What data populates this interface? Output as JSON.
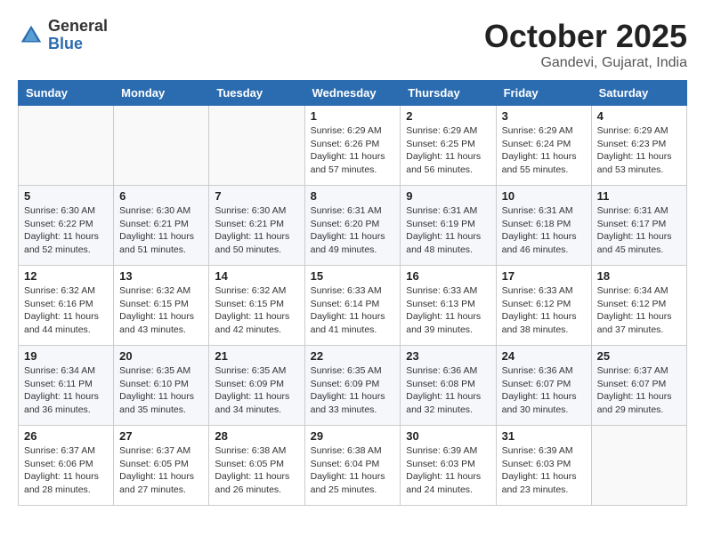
{
  "header": {
    "logo_general": "General",
    "logo_blue": "Blue",
    "month_title": "October 2025",
    "location": "Gandevi, Gujarat, India"
  },
  "weekdays": [
    "Sunday",
    "Monday",
    "Tuesday",
    "Wednesday",
    "Thursday",
    "Friday",
    "Saturday"
  ],
  "weeks": [
    [
      null,
      null,
      null,
      {
        "day": 1,
        "sunrise": "6:29 AM",
        "sunset": "6:26 PM",
        "daylight": "11 hours and 57 minutes."
      },
      {
        "day": 2,
        "sunrise": "6:29 AM",
        "sunset": "6:25 PM",
        "daylight": "11 hours and 56 minutes."
      },
      {
        "day": 3,
        "sunrise": "6:29 AM",
        "sunset": "6:24 PM",
        "daylight": "11 hours and 55 minutes."
      },
      {
        "day": 4,
        "sunrise": "6:29 AM",
        "sunset": "6:23 PM",
        "daylight": "11 hours and 53 minutes."
      }
    ],
    [
      {
        "day": 5,
        "sunrise": "6:30 AM",
        "sunset": "6:22 PM",
        "daylight": "11 hours and 52 minutes."
      },
      {
        "day": 6,
        "sunrise": "6:30 AM",
        "sunset": "6:21 PM",
        "daylight": "11 hours and 51 minutes."
      },
      {
        "day": 7,
        "sunrise": "6:30 AM",
        "sunset": "6:21 PM",
        "daylight": "11 hours and 50 minutes."
      },
      {
        "day": 8,
        "sunrise": "6:31 AM",
        "sunset": "6:20 PM",
        "daylight": "11 hours and 49 minutes."
      },
      {
        "day": 9,
        "sunrise": "6:31 AM",
        "sunset": "6:19 PM",
        "daylight": "11 hours and 48 minutes."
      },
      {
        "day": 10,
        "sunrise": "6:31 AM",
        "sunset": "6:18 PM",
        "daylight": "11 hours and 46 minutes."
      },
      {
        "day": 11,
        "sunrise": "6:31 AM",
        "sunset": "6:17 PM",
        "daylight": "11 hours and 45 minutes."
      }
    ],
    [
      {
        "day": 12,
        "sunrise": "6:32 AM",
        "sunset": "6:16 PM",
        "daylight": "11 hours and 44 minutes."
      },
      {
        "day": 13,
        "sunrise": "6:32 AM",
        "sunset": "6:15 PM",
        "daylight": "11 hours and 43 minutes."
      },
      {
        "day": 14,
        "sunrise": "6:32 AM",
        "sunset": "6:15 PM",
        "daylight": "11 hours and 42 minutes."
      },
      {
        "day": 15,
        "sunrise": "6:33 AM",
        "sunset": "6:14 PM",
        "daylight": "11 hours and 41 minutes."
      },
      {
        "day": 16,
        "sunrise": "6:33 AM",
        "sunset": "6:13 PM",
        "daylight": "11 hours and 39 minutes."
      },
      {
        "day": 17,
        "sunrise": "6:33 AM",
        "sunset": "6:12 PM",
        "daylight": "11 hours and 38 minutes."
      },
      {
        "day": 18,
        "sunrise": "6:34 AM",
        "sunset": "6:12 PM",
        "daylight": "11 hours and 37 minutes."
      }
    ],
    [
      {
        "day": 19,
        "sunrise": "6:34 AM",
        "sunset": "6:11 PM",
        "daylight": "11 hours and 36 minutes."
      },
      {
        "day": 20,
        "sunrise": "6:35 AM",
        "sunset": "6:10 PM",
        "daylight": "11 hours and 35 minutes."
      },
      {
        "day": 21,
        "sunrise": "6:35 AM",
        "sunset": "6:09 PM",
        "daylight": "11 hours and 34 minutes."
      },
      {
        "day": 22,
        "sunrise": "6:35 AM",
        "sunset": "6:09 PM",
        "daylight": "11 hours and 33 minutes."
      },
      {
        "day": 23,
        "sunrise": "6:36 AM",
        "sunset": "6:08 PM",
        "daylight": "11 hours and 32 minutes."
      },
      {
        "day": 24,
        "sunrise": "6:36 AM",
        "sunset": "6:07 PM",
        "daylight": "11 hours and 30 minutes."
      },
      {
        "day": 25,
        "sunrise": "6:37 AM",
        "sunset": "6:07 PM",
        "daylight": "11 hours and 29 minutes."
      }
    ],
    [
      {
        "day": 26,
        "sunrise": "6:37 AM",
        "sunset": "6:06 PM",
        "daylight": "11 hours and 28 minutes."
      },
      {
        "day": 27,
        "sunrise": "6:37 AM",
        "sunset": "6:05 PM",
        "daylight": "11 hours and 27 minutes."
      },
      {
        "day": 28,
        "sunrise": "6:38 AM",
        "sunset": "6:05 PM",
        "daylight": "11 hours and 26 minutes."
      },
      {
        "day": 29,
        "sunrise": "6:38 AM",
        "sunset": "6:04 PM",
        "daylight": "11 hours and 25 minutes."
      },
      {
        "day": 30,
        "sunrise": "6:39 AM",
        "sunset": "6:03 PM",
        "daylight": "11 hours and 24 minutes."
      },
      {
        "day": 31,
        "sunrise": "6:39 AM",
        "sunset": "6:03 PM",
        "daylight": "11 hours and 23 minutes."
      },
      null
    ]
  ]
}
